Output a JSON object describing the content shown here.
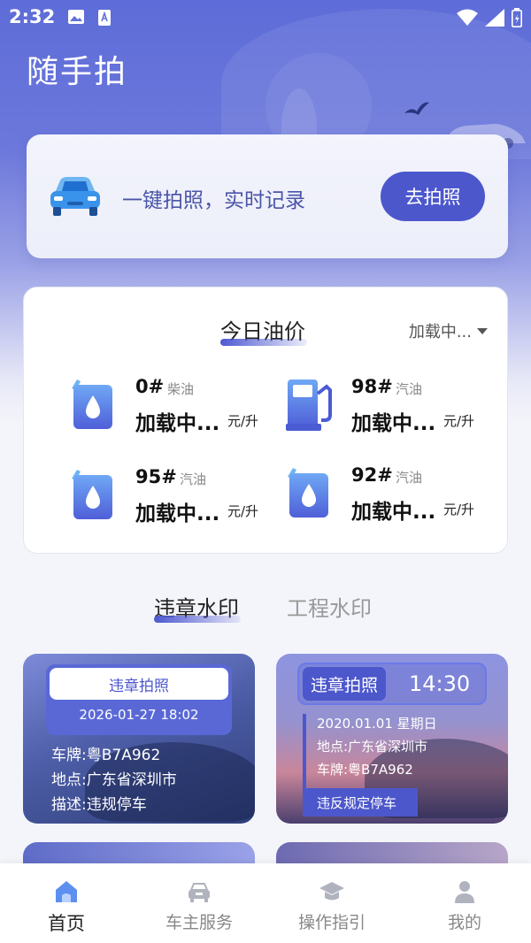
{
  "status_bar": {
    "time": "2:32"
  },
  "app_title": "随手拍",
  "photo_card": {
    "slogan": "一键拍照，实时记录",
    "button": "去拍照"
  },
  "oil_prices": {
    "title": "今日油价",
    "region": "加载中...",
    "items": [
      {
        "grade": "0#",
        "type": "柴油",
        "price": "加载中...",
        "unit": "元/升",
        "icon": "fuel-can-icon"
      },
      {
        "grade": "98#",
        "type": "汽油",
        "price": "加载中...",
        "unit": "元/升",
        "icon": "fuel-pump-icon"
      },
      {
        "grade": "95#",
        "type": "汽油",
        "price": "加载中...",
        "unit": "元/升",
        "icon": "fuel-can-icon"
      },
      {
        "grade": "92#",
        "type": "汽油",
        "price": "加载中...",
        "unit": "元/升",
        "icon": "fuel-can-icon"
      }
    ]
  },
  "watermark_tabs": {
    "active": "违章水印",
    "inactive": "工程水印"
  },
  "watermark_cards": [
    {
      "header": "违章拍照",
      "datetime": "2026-01-27 18:02",
      "lines": [
        "车牌:粤B7A962",
        "地点:广东省深圳市",
        "描述:违规停车"
      ]
    },
    {
      "tag": "违章拍照",
      "time": "14:30",
      "lines": [
        "2020.01.01 星期日",
        "地点:广东省深圳市",
        "车牌:粤B7A962"
      ],
      "footer": "违反规定停车"
    }
  ],
  "bottom_nav": [
    {
      "label": "首页",
      "icon": "home-icon",
      "active": true
    },
    {
      "label": "车主服务",
      "icon": "car-icon",
      "active": false
    },
    {
      "label": "操作指引",
      "icon": "graduation-cap-icon",
      "active": false
    },
    {
      "label": "我的",
      "icon": "user-icon",
      "active": false
    }
  ],
  "colors": {
    "accent": "#4c57cc",
    "hero": "#5d6cd8",
    "background": "#f4f5fa"
  }
}
